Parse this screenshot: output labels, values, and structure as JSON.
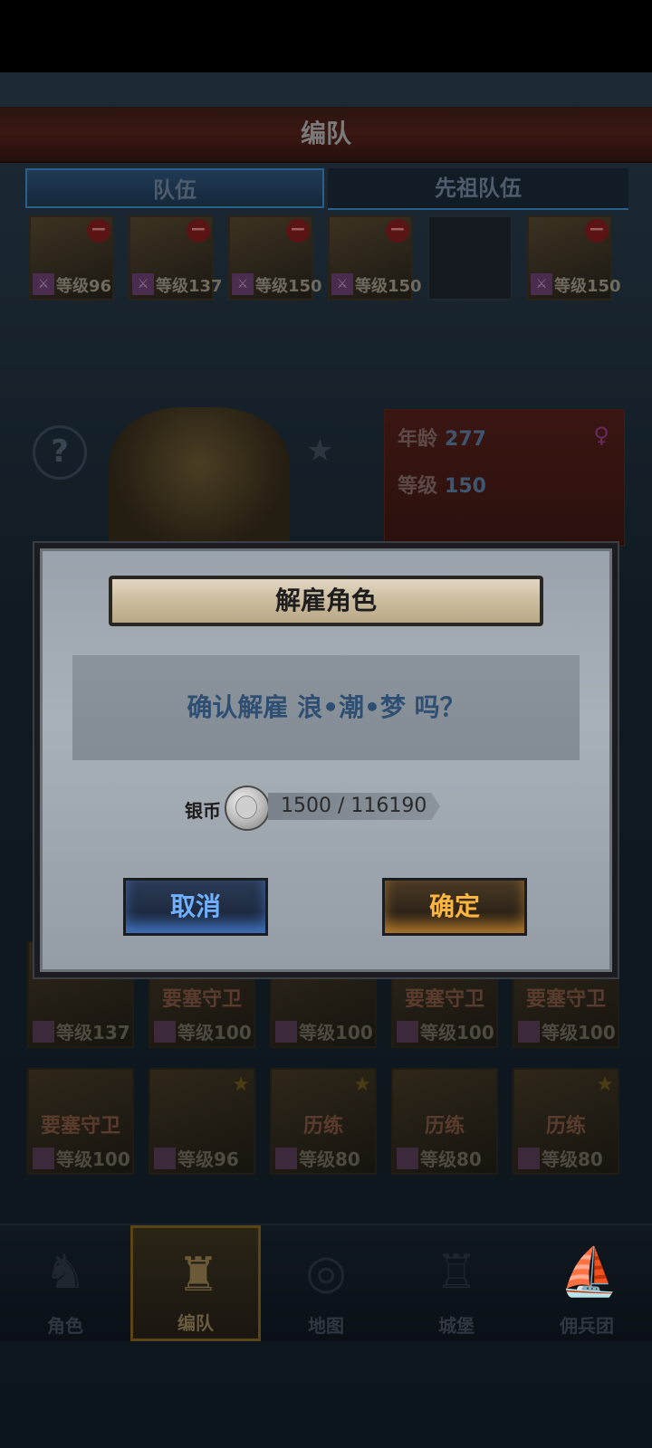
{
  "header": {
    "title": "编队"
  },
  "tabs": [
    {
      "label": "队伍"
    },
    {
      "label": "先祖队伍"
    }
  ],
  "team_slots": [
    {
      "level": "等级96",
      "empty": false
    },
    {
      "level": "等级137",
      "empty": false
    },
    {
      "level": "等级150",
      "empty": false
    },
    {
      "level": "等级150",
      "empty": false
    },
    {
      "level": "",
      "empty": true
    },
    {
      "level": "等级150",
      "empty": false
    }
  ],
  "hero_info": {
    "age_label": "年龄",
    "age_value": "277",
    "level_label": "等级",
    "level_value": "150"
  },
  "roster": [
    {
      "tag": "",
      "level": "等级137"
    },
    {
      "tag": "要塞守卫",
      "level": "等级100"
    },
    {
      "tag": "",
      "level": "等级100"
    },
    {
      "tag": "要塞守卫",
      "level": "等级100"
    },
    {
      "tag": "要塞守卫",
      "level": "等级100"
    },
    {
      "tag": "要塞守卫",
      "level": "等级100"
    },
    {
      "tag": "",
      "level": "等级96"
    },
    {
      "tag": "历练",
      "level": "等级80"
    },
    {
      "tag": "历练",
      "level": "等级80"
    },
    {
      "tag": "历练",
      "level": "等级80"
    }
  ],
  "nav": [
    {
      "label": "角色",
      "icon": "knight-icon"
    },
    {
      "label": "编队",
      "icon": "formation-icon"
    },
    {
      "label": "地图",
      "icon": "compass-icon"
    },
    {
      "label": "城堡",
      "icon": "castle-icon"
    },
    {
      "label": "佣兵团",
      "icon": "ship-icon"
    }
  ],
  "dialog": {
    "title": "解雇角色",
    "message": "确认解雇 浪•潮•梦 吗？",
    "cost_label": "银币",
    "cost_value": "1500 / 116190",
    "cancel_label": "取消",
    "confirm_label": "确定"
  }
}
